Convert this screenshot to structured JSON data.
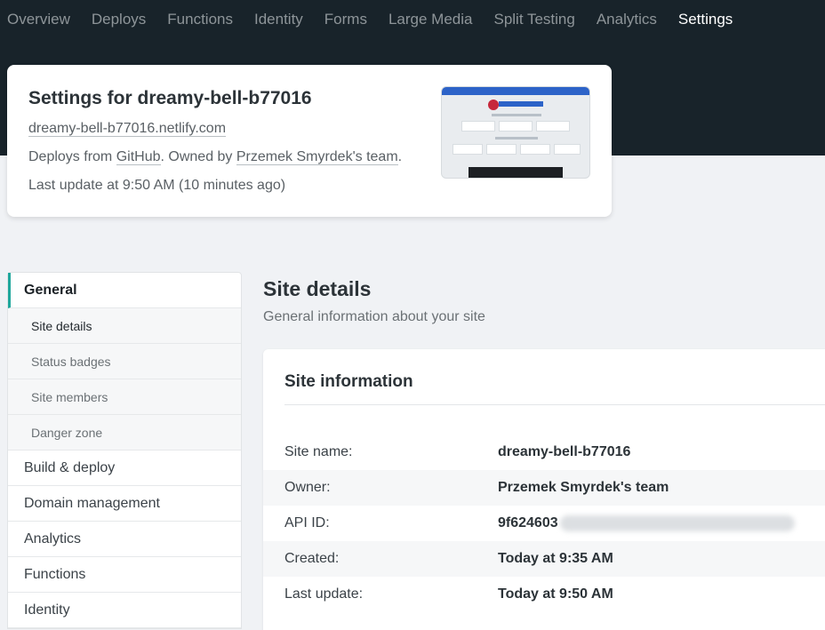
{
  "topnav": {
    "items": [
      {
        "label": "Overview"
      },
      {
        "label": "Deploys"
      },
      {
        "label": "Functions"
      },
      {
        "label": "Identity"
      },
      {
        "label": "Forms"
      },
      {
        "label": "Large Media"
      },
      {
        "label": "Split Testing"
      },
      {
        "label": "Analytics"
      },
      {
        "label": "Settings",
        "active": true
      }
    ]
  },
  "site_card": {
    "title": "Settings for dreamy-bell-b77016",
    "url": "dreamy-bell-b77016.netlify.com",
    "deploys_prefix": "Deploys from ",
    "deploys_source": "GitHub",
    "owned_prefix": ". Owned by ",
    "owner": "Przemek Smyrdek's team",
    "owned_suffix": ".",
    "last_update": "Last update at 9:50 AM (10 minutes ago)"
  },
  "sidebar": {
    "general": "General",
    "sub_items": [
      "Site details",
      "Status badges",
      "Site members",
      "Danger zone"
    ],
    "items": [
      "Build & deploy",
      "Domain management",
      "Analytics",
      "Functions",
      "Identity"
    ]
  },
  "main": {
    "title": "Site details",
    "subtitle": "General information about your site",
    "card_title": "Site information",
    "rows": [
      {
        "label": "Site name:",
        "value": "dreamy-bell-b77016"
      },
      {
        "label": "Owner:",
        "value": "Przemek Smyrdek's team"
      },
      {
        "label": "API ID:",
        "value": "9f624603"
      },
      {
        "label": "Created:",
        "value": "Today at 9:35 AM"
      },
      {
        "label": "Last update:",
        "value": "Today at 9:50 AM"
      }
    ]
  },
  "colors": {
    "header_bg": "#18232a",
    "accent": "#1fa79c",
    "page_bg": "#f0f2f5"
  }
}
